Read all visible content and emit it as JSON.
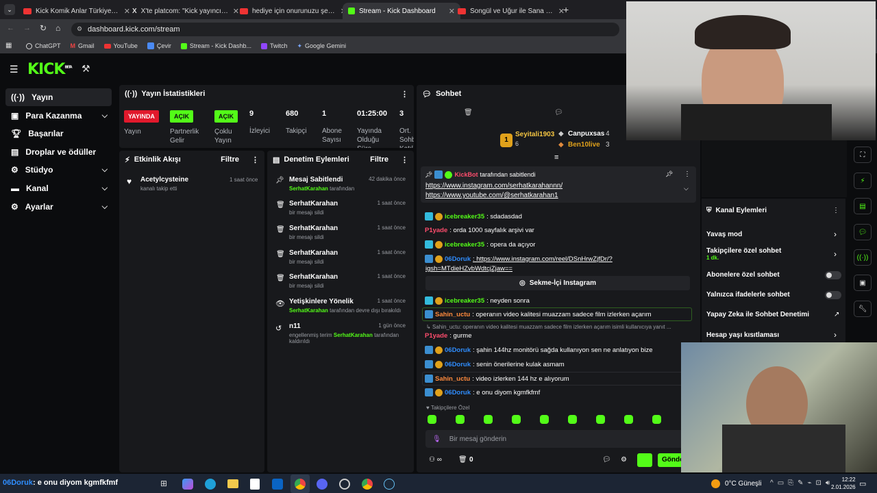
{
  "browser": {
    "tabs": [
      {
        "title": "Kick Komik Anlar Türkiye Rewin",
        "fav": "#e33"
      },
      {
        "title": "X'te platcom: \"Kick yayıncısı Ca",
        "fav": "#000"
      },
      {
        "title": "hediye için onurunuzu şerefini",
        "fav": "#e33"
      },
      {
        "title": "Stream - Kick Dashboard",
        "fav": "#53fc18"
      },
      {
        "title": "Songül ve Uğur ile Sana Değer",
        "fav": "#e33"
      }
    ],
    "url": "dashboard.kick.com/stream",
    "bookmarks": [
      "ChatGPT",
      "Gmail",
      "YouTube",
      "Çevir",
      "Stream - Kick Dashb...",
      "Twitch",
      "Google Gemini"
    ]
  },
  "kick": {
    "logo": "KICK",
    "logo_beta": "BETA"
  },
  "sidebar": {
    "items": [
      {
        "label": "Yayın",
        "icon": "broadcast-icon"
      },
      {
        "label": "Para Kazanma",
        "icon": "money-icon"
      },
      {
        "label": "Başarılar",
        "icon": "trophy-icon"
      },
      {
        "label": "Droplar ve ödüller",
        "icon": "gift-icon"
      },
      {
        "label": "Stüdyo",
        "icon": "gear-icon"
      },
      {
        "label": "Kanal",
        "icon": "channel-icon"
      },
      {
        "label": "Ayarlar",
        "icon": "settings-icon"
      }
    ]
  },
  "stats": {
    "title": "Yayın İstatistikleri",
    "live_badge": "YAYINDA",
    "on1": "AÇIK",
    "on2": "AÇIK",
    "labels": {
      "yayin": "Yayın",
      "partnerlik": "Partnerlik Gelir",
      "coklu": "Çoklu Yayın",
      "izleyici": "İzleyici",
      "takipci": "Takipçi",
      "abone": "Abone Sayısı",
      "sure": "Yayında Olduğu Süre",
      "ort": "Ort. Sohb. Katıl."
    },
    "values": {
      "izleyici": "9",
      "takipci": "680",
      "abone": "1",
      "sure": "01:25:00",
      "ort": "3"
    }
  },
  "activity": {
    "title": "Etkinlik Akışı",
    "filter": "Filtre",
    "items": [
      {
        "name": "Acetylcysteine",
        "sub": "kanalı takip etti",
        "time": "1 saat önce"
      }
    ]
  },
  "moderation": {
    "title": "Denetim Eylemleri",
    "filter": "Filtre",
    "items": [
      {
        "name": "Mesaj Sabitlendi",
        "who": "SerhatKarahan",
        "sub": " tarafından",
        "time": "42 dakika önce"
      },
      {
        "name": "SerhatKarahan",
        "who": "",
        "sub": "bir mesajı sildi",
        "time": "1 saat önce"
      },
      {
        "name": "SerhatKarahan",
        "who": "",
        "sub": "bir mesajı sildi",
        "time": "1 saat önce"
      },
      {
        "name": "SerhatKarahan",
        "who": "",
        "sub": "bir mesajı sildi",
        "time": "1 saat önce"
      },
      {
        "name": "SerhatKarahan",
        "who": "",
        "sub": "bir mesajı sildi",
        "time": "1 saat önce"
      },
      {
        "name": "Yetişkinlere Yönelik",
        "who": "SerhatKarahan",
        "sub": " tarafından devre dışı bırakıldı",
        "time": "1 saat önce"
      },
      {
        "name": "n11",
        "who": "SerhatKarahan",
        "sub": "engellenmiş terim ",
        "sub2": " tarafından kaldırıldı",
        "time": "1 gün önce"
      }
    ]
  },
  "chat": {
    "title": "Sohbet",
    "top": [
      {
        "name": "Seyitali1903",
        "count": "6"
      },
      {
        "name": "Canpuxsas",
        "count": "4"
      },
      {
        "name": "Ben10live",
        "count": "3"
      }
    ],
    "pinned_by": "KickBot",
    "pinned_text": " tarafından sabitlendi",
    "pinned_link1": "https://www.instagram.com/serhatkarahannn/",
    "pinned_link2": "https://www.youtube.com/@serhatkarahan1",
    "messages": [
      {
        "user": "icebreaker35",
        "cls": "u1",
        "text": ": sdadasdad"
      },
      {
        "user": "P1yade",
        "cls": "u3",
        "text": ": orda 1000 sayfalık arşivi var"
      },
      {
        "user": "icebreaker35",
        "cls": "u1",
        "text": ": opera da açıyor"
      },
      {
        "user": "06Doruk",
        "cls": "u2",
        "text": ": https://www.instagram.com/reel/DSnHrwZjfDr/?"
      },
      {
        "user": "icebreaker35",
        "cls": "u1",
        "text": ": neyden sonra"
      },
      {
        "user": "Sahin_uctu",
        "cls": "u4",
        "text": ": operanın video kalitesi muazzam sadece film izlerken açarım"
      },
      {
        "user": "P1yade",
        "cls": "u3",
        "text": ": gurme"
      },
      {
        "user": "06Doruk",
        "cls": "u2",
        "text": ": şahin 144hz monitörü sağda kullanıyon sen ne anlatıyon bize"
      },
      {
        "user": "06Doruk",
        "cls": "u2",
        "text": ": senin önerilerine kulak asmam"
      },
      {
        "user": "Sahin_uctu",
        "cls": "u4",
        "text": ": video izlerken 144 hz e alıyorum"
      },
      {
        "user": "06Doruk",
        "cls": "u2",
        "text": ": e onu diyom kgmfkfmf"
      }
    ],
    "link_cont": "igsh=MTdieHZvbWdtcjZjaw==",
    "instagram_card": "Sekme-İçi Instagram",
    "reply_preview": "Sahin_uctu: operanın video kalitesi muazzam sadece film izlerken açarım isimli kullanıcıya yanıt ...",
    "followers_only": "Takipçilere Özel",
    "input_placeholder": "Bir mesaj gönderin",
    "points": "0",
    "send": "Gönder"
  },
  "channel_actions": {
    "title": "Kanal Eylemleri",
    "items": [
      {
        "label": "Yavaş mod",
        "sub": ""
      },
      {
        "label": "Takipçilere özel sohbet",
        "sub": "1 dk."
      },
      {
        "label": "Abonelere özel sohbet",
        "sub": ""
      },
      {
        "label": "Yalnızca ifadelerle sohbet",
        "sub": ""
      },
      {
        "label": "Yapay Zeka ile Sohbet Denetimi",
        "sub": ""
      },
      {
        "label": "Hesap yaşı kısıtlaması",
        "sub": ""
      }
    ]
  },
  "taskbar": {
    "ticker_user": "06Doruk",
    "ticker_text": ": e onu diyom kgmfkfmf",
    "weather": "0°C Güneşli",
    "time": "12:22",
    "date": "2.01.2026"
  }
}
